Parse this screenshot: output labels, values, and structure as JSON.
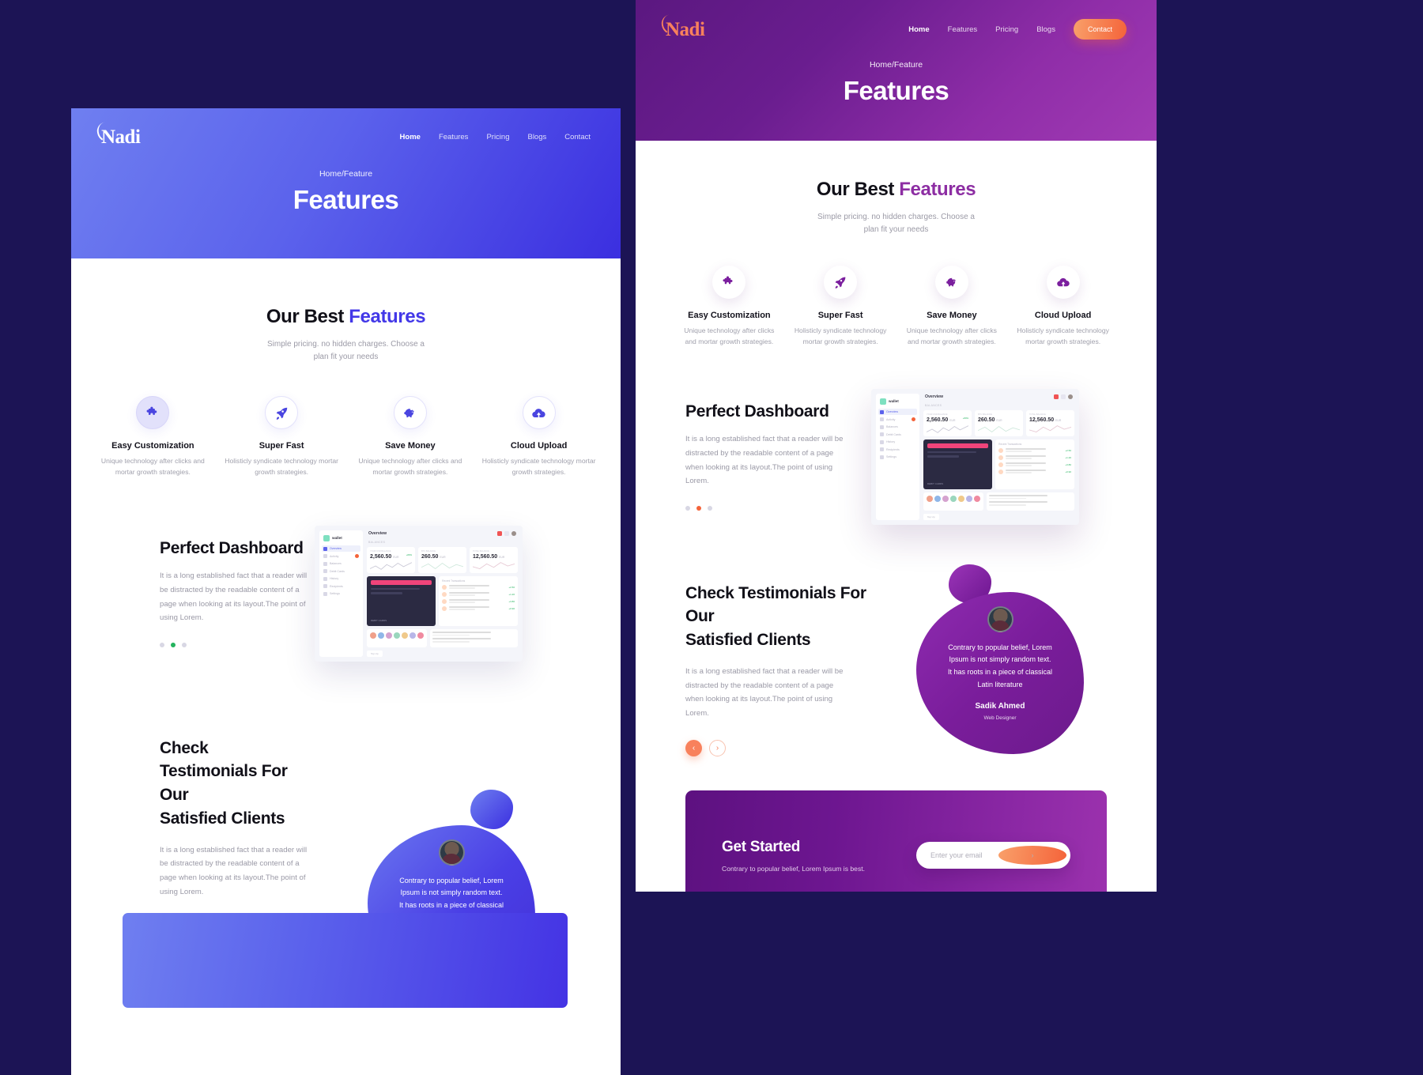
{
  "brand": {
    "name": "Nadi"
  },
  "nav": {
    "items": [
      {
        "label": "Home",
        "active": true
      },
      {
        "label": "Features",
        "active": false
      },
      {
        "label": "Pricing",
        "active": false
      },
      {
        "label": "Blogs",
        "active": false
      },
      {
        "label": "Contact",
        "active": false
      }
    ],
    "contact_button": "Contact"
  },
  "hero": {
    "breadcrumb": "Home/Feature",
    "title": "Features"
  },
  "features_section": {
    "title_plain": "Our Best ",
    "title_accent": "Features",
    "subtitle": "Simple pricing. no hidden charges. Choose a plan fit your needs",
    "items": [
      {
        "icon": "puzzle-icon",
        "title": "Easy Customization",
        "desc": "Unique technology after clicks and mortar growth strategies."
      },
      {
        "icon": "rocket-icon",
        "title": "Super Fast",
        "desc": "Holisticly syndicate technology mortar growth strategies."
      },
      {
        "icon": "piggy-bank-icon",
        "title": "Save Money",
        "desc": "Unique technology after clicks and mortar growth strategies."
      },
      {
        "icon": "cloud-upload-icon",
        "title": "Cloud Upload",
        "desc": "Holisticly syndicate technology mortar growth strategies."
      }
    ]
  },
  "dashboard_section": {
    "title_plain": "Perfect ",
    "title_accent": "Dashboard",
    "body": "It is a long established fact that a reader will be distracted by the readable content of a page when looking at its layout.The point of using Lorem.",
    "dots_active_index": 1,
    "dots_count": 3
  },
  "mockup": {
    "brand": "wallet",
    "overview_title": "Overview",
    "balances_label": "BALANCES",
    "nav_items": [
      "Overview",
      "Activity",
      "Balances",
      "Debit Cards",
      "History",
      "Recipients",
      "Settings"
    ],
    "nav_selected": "Overview",
    "cards": [
      {
        "caption": "YOUR USD BALANCE",
        "value": "2,560.50",
        "currency": "EUR",
        "change": "+80%",
        "note": "this week"
      },
      {
        "caption": "BTC BALANCE",
        "value": "260.50",
        "currency": "EUR"
      },
      {
        "caption": "TOTAL BALANCE",
        "value": "12,560.50",
        "currency": "EUR"
      }
    ],
    "debit_card_label": "DEBIT CARDS",
    "transactions_label": "Recent Transactions",
    "footer_button": "Top Up"
  },
  "testimonials_section": {
    "title_line1": "Check Testimonials For Our",
    "title_line2_plain": "Satisfied ",
    "title_line2_accent": "Clients",
    "body": "It is a long established fact that a reader will be distracted by the readable content of a page when looking at its layout.The point of using Lorem.",
    "prev_icon": "chevron-left-icon",
    "next_icon": "chevron-right-icon",
    "quote": "Contrary to popular belief, Lorem Ipsum is not simply random text. It has roots in a piece of classical Latin literature",
    "author": "Sadik Ahmed",
    "role": "Web Designer"
  },
  "cta_section": {
    "title": "Get Started",
    "subtitle": "Contrary to popular belief, Lorem Ipsum is best.",
    "email_placeholder": "Enter your email",
    "submit_icon": "arrow-right-icon"
  },
  "colors": {
    "blue_accent": "#4338e8",
    "purple_accent": "#8d2ea3",
    "orange_accent": "#f4633a",
    "green_accent": "#24b35e",
    "page_background": "#1c1455"
  }
}
